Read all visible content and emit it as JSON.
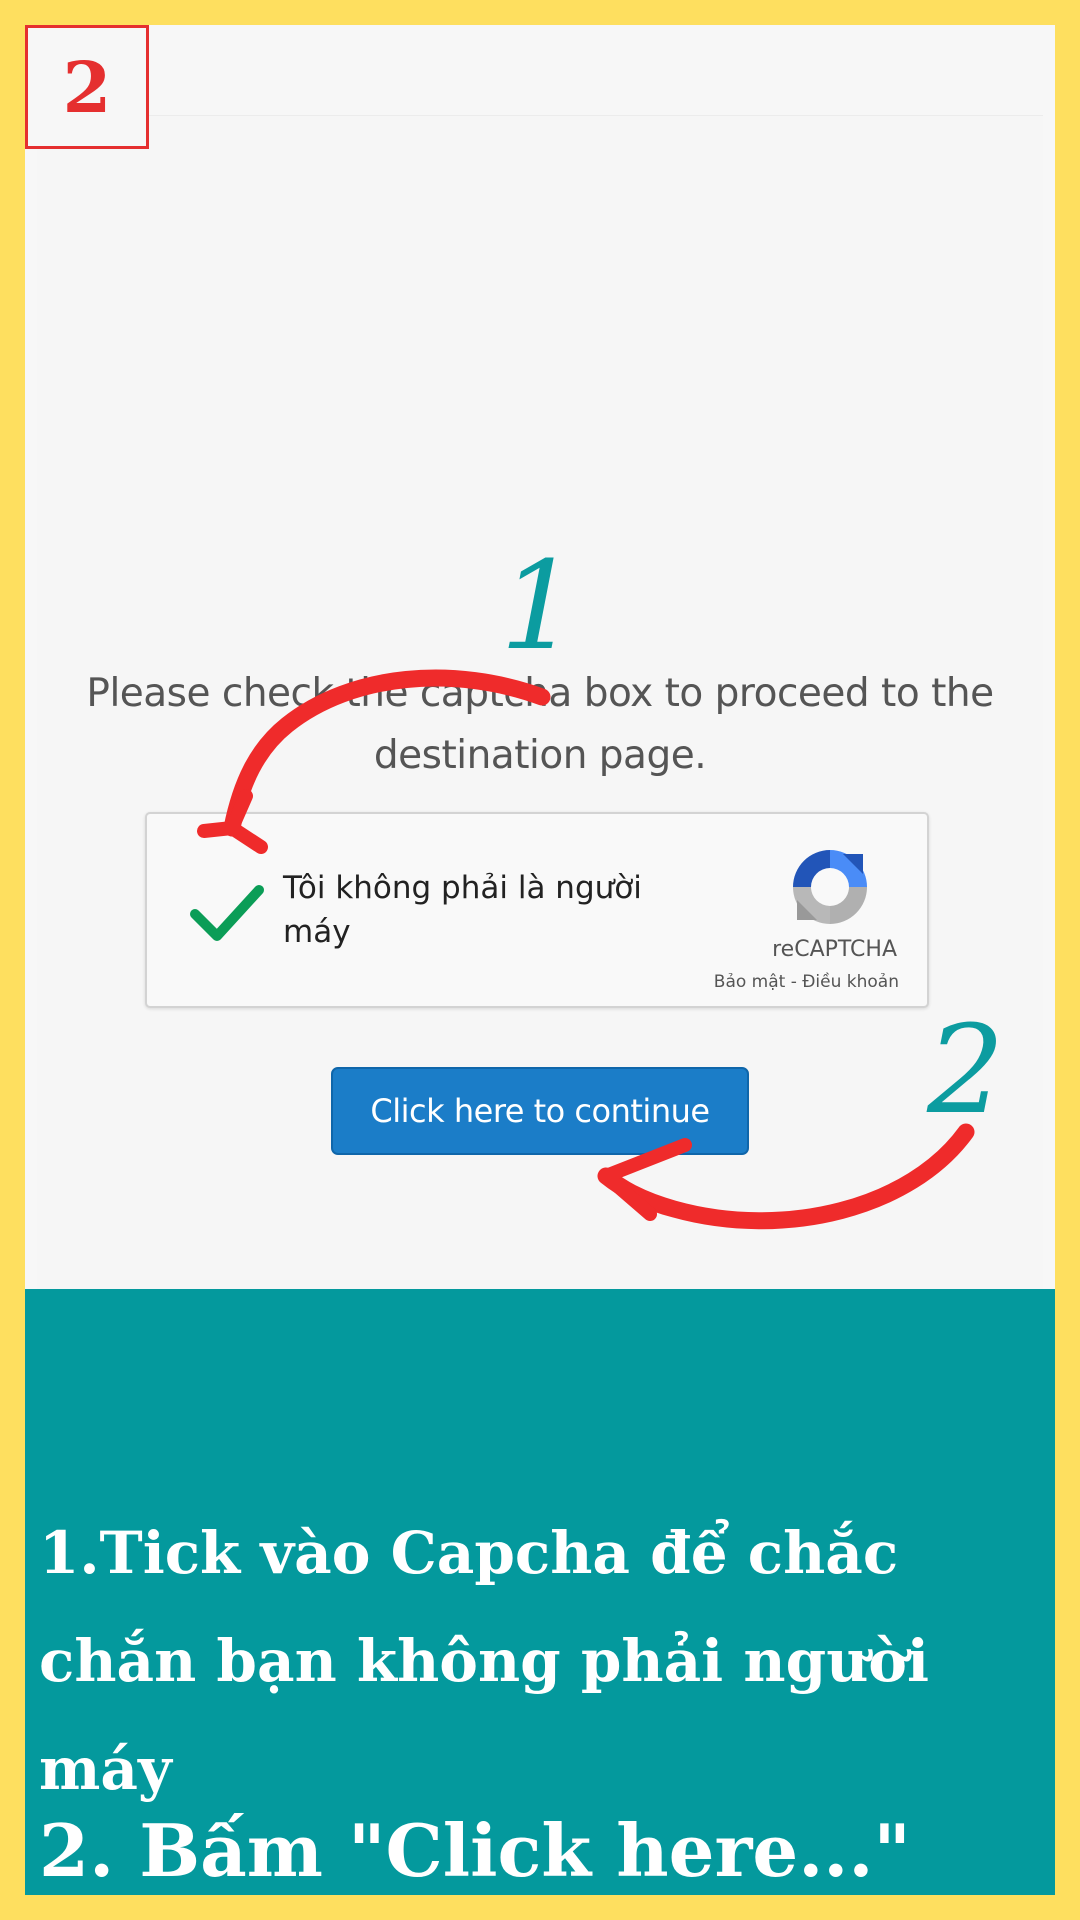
{
  "badge": {
    "number": "2"
  },
  "page": {
    "prompt": "Please check the captcha box to proceed to the destination page."
  },
  "recaptcha": {
    "label": "Tôi không phải là người máy",
    "brand": "reCAPTCHA",
    "links": "Bảo mật - Điều khoản",
    "checked": true
  },
  "button": {
    "label": "Click here to continue"
  },
  "annotations": {
    "step_one": "1",
    "step_two": "2"
  },
  "instructions": {
    "line_one": "1.Tick vào Capcha để chắc chắn bạn không phải người máy",
    "line_two": "2. Bấm \"Click here...\""
  },
  "colors": {
    "border_yellow": "#fedf5f",
    "teal": "#04999d",
    "red_arrow": "#ef2b2b",
    "button_blue": "#1b7dc8",
    "check_green": "#0b9d57"
  }
}
